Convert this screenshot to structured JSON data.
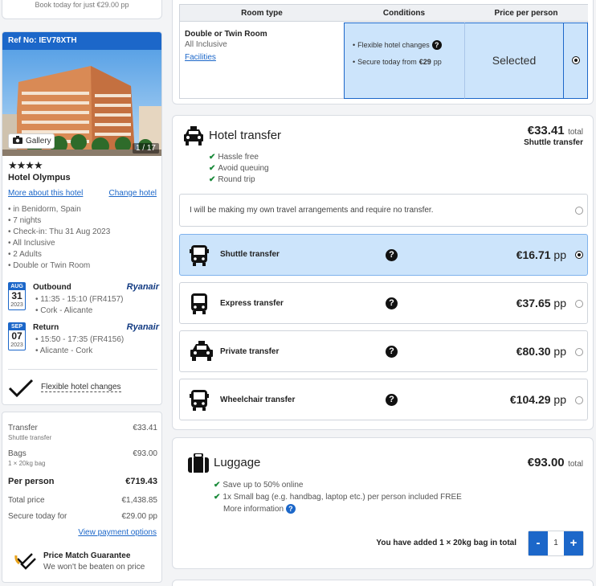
{
  "top_note": "Book today for just €29.00 pp",
  "hotel": {
    "ref": "Ref No: IEV78XTH",
    "gallery_label": "Gallery",
    "photo_count": "1 / 17",
    "stars": "★★★★",
    "name": "Hotel Olympus",
    "more_link": "More about this hotel",
    "change_link": "Change hotel",
    "details": [
      "in Benidorm, Spain",
      "7 nights",
      "Check-in: Thu 31 Aug 2023",
      "All Inclusive",
      "2 Adults",
      "Double or Twin Room"
    ]
  },
  "flights": {
    "outbound": {
      "month": "AUG",
      "day": "31",
      "year": "2023",
      "title": "Outbound",
      "airline": "Ryanair",
      "time": "11:35 - 15:10 (FR4157)",
      "route": "Cork - Alicante"
    },
    "return": {
      "month": "SEP",
      "day": "07",
      "year": "2023",
      "title": "Return",
      "airline": "Ryanair",
      "time": "15:50 - 17:35 (FR4156)",
      "route": "Alicante - Cork"
    }
  },
  "flexible_label": "Flexible hotel changes",
  "summary": {
    "transfer_label": "Transfer",
    "transfer_value": "€33.41",
    "transfer_sub": "Shuttle transfer",
    "bags_label": "Bags",
    "bags_value": "€93.00",
    "bags_sub": "1 × 20kg bag",
    "per_person_label": "Per person",
    "per_person_value": "€719.43",
    "total_label": "Total price",
    "total_value": "€1,438.85",
    "secure_label": "Secure today for",
    "secure_value": "€29.00 pp",
    "payment_link": "View payment options",
    "pm_title": "Price Match Guarantee",
    "pm_sub": "We won't be beaten on price"
  },
  "room_table": {
    "headers": [
      "Room type",
      "Conditions",
      "Price per person"
    ],
    "room_name": "Double or Twin Room",
    "board": "All Inclusive",
    "facilities_link": "Facilities",
    "cond1": "Flexible hotel changes",
    "cond2_prefix": "Secure today from ",
    "cond2_amount": "€29",
    "cond2_suffix": " pp",
    "price": "Selected"
  },
  "transfer": {
    "title": "Hotel transfer",
    "total": "€33.41",
    "total_label": "total",
    "total_sub": "Shuttle transfer",
    "checks": [
      "Hassle free",
      "Avoid queuing",
      "Round trip"
    ],
    "no_transfer": "I will be making my own travel arrangements and require no transfer.",
    "options": [
      {
        "name": "Shuttle transfer",
        "price": "€16.71",
        "unit": "pp",
        "icon": "bus-icon"
      },
      {
        "name": "Express transfer",
        "price": "€37.65",
        "unit": "pp",
        "icon": "bus-icon"
      },
      {
        "name": "Private transfer",
        "price": "€80.30",
        "unit": "pp",
        "icon": "taxi-icon"
      },
      {
        "name": "Wheelchair transfer",
        "price": "€104.29",
        "unit": "pp",
        "icon": "bus-icon"
      }
    ]
  },
  "luggage": {
    "title": "Luggage",
    "total": "€93.00",
    "total_label": "total",
    "checks": [
      "Save up to 50% online",
      "1x Small bag (e.g. handbag, laptop etc.) per person included FREE"
    ],
    "more_info": "More information",
    "added_text": "You have added 1 × 20kg bag in total",
    "minus": "-",
    "quantity": "1",
    "plus": "+"
  },
  "colors": {
    "accent": "#1c67c9",
    "selected_bg": "#cce4fb",
    "check_green": "#1a8a3a",
    "ryanair": "#113a82"
  }
}
